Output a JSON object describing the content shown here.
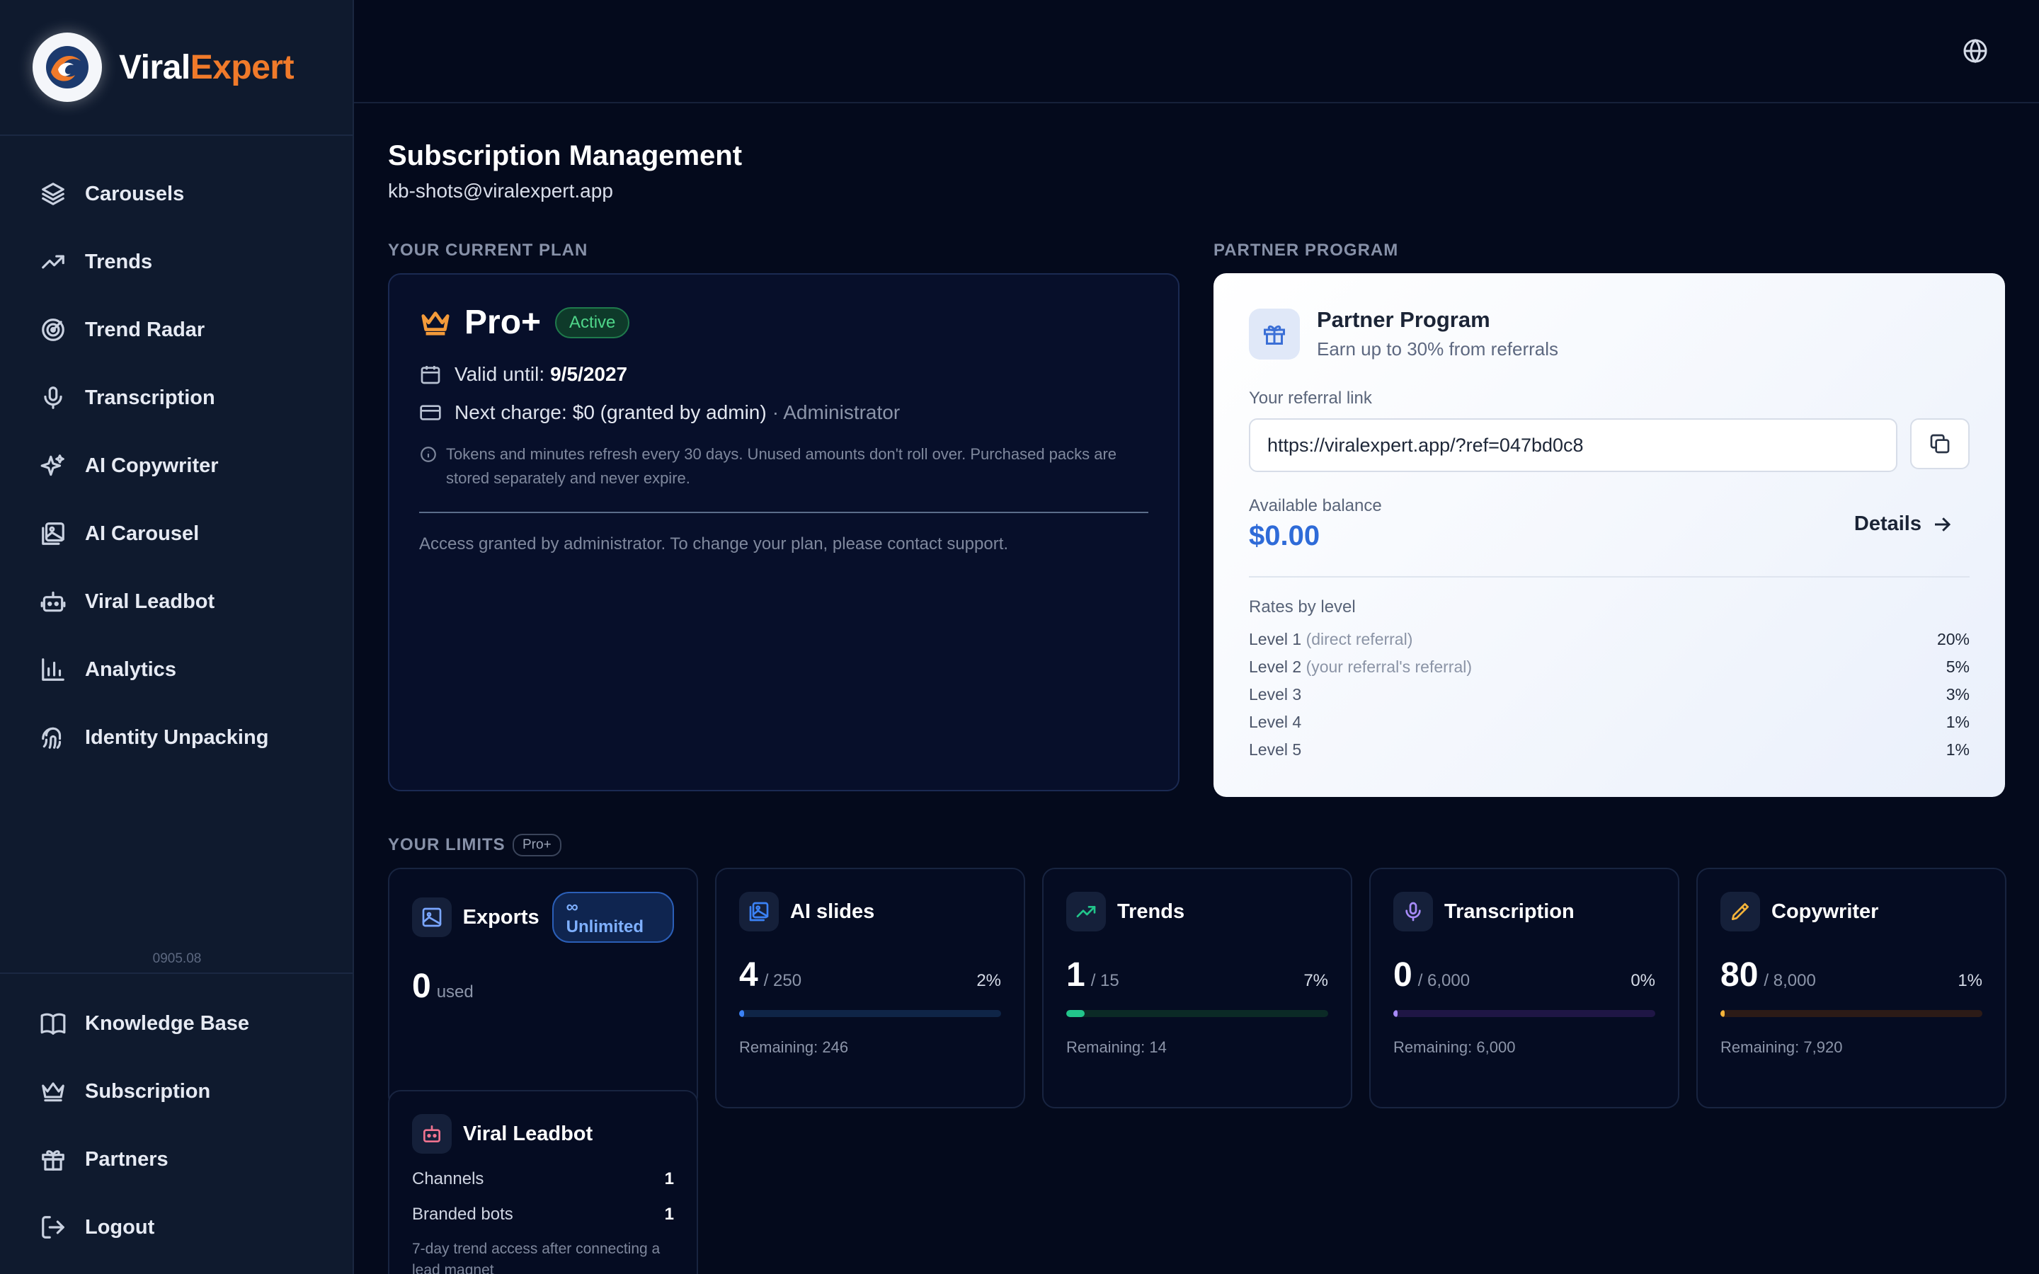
{
  "brand": {
    "name_part1": "Viral",
    "name_part2": "Expert"
  },
  "sidebar": {
    "items": [
      {
        "label": "Carousels",
        "icon": "layers-icon"
      },
      {
        "label": "Trends",
        "icon": "trending-up-icon"
      },
      {
        "label": "Trend Radar",
        "icon": "radar-icon"
      },
      {
        "label": "Transcription",
        "icon": "microphone-icon"
      },
      {
        "label": "AI Copywriter",
        "icon": "sparkles-icon"
      },
      {
        "label": "AI Carousel",
        "icon": "images-icon"
      },
      {
        "label": "Viral Leadbot",
        "icon": "bot-icon"
      },
      {
        "label": "Analytics",
        "icon": "bar-chart-icon"
      },
      {
        "label": "Identity Unpacking",
        "icon": "fingerprint-icon"
      }
    ],
    "version": "0905.08",
    "bottom_items": [
      {
        "label": "Knowledge Base",
        "icon": "book-icon"
      },
      {
        "label": "Subscription",
        "icon": "crown-icon"
      },
      {
        "label": "Partners",
        "icon": "gift-icon"
      },
      {
        "label": "Logout",
        "icon": "logout-icon"
      }
    ]
  },
  "header": {
    "language_icon": "globe-icon"
  },
  "page": {
    "title": "Subscription Management",
    "email": "kb-shots@viralexpert.app"
  },
  "plan": {
    "section_label": "YOUR CURRENT PLAN",
    "name": "Pro+",
    "status": "Active",
    "valid_label": "Valid until:",
    "valid_date": "9/5/2027",
    "charge_label": "Next charge:",
    "charge_value": "$0 (granted by admin)",
    "charge_role": "· Administrator",
    "note": "Tokens and minutes refresh every 30 days. Unused amounts don't roll over. Purchased packs are stored separately and never expire.",
    "footer": "Access granted by administrator. To change your plan, please contact support."
  },
  "partner": {
    "section_label": "PARTNER PROGRAM",
    "title": "Partner Program",
    "subtitle": "Earn up to 30% from referrals",
    "link_label": "Your referral link",
    "link": "https://viralexpert.app/?ref=047bd0c8",
    "balance_label": "Available balance",
    "balance": "$0.00",
    "details_label": "Details",
    "rates_label": "Rates by level",
    "rates": [
      {
        "level": "Level 1",
        "note": "(direct referral)",
        "pct": "20%"
      },
      {
        "level": "Level 2",
        "note": "(your referral's referral)",
        "pct": "5%"
      },
      {
        "level": "Level 3",
        "note": "",
        "pct": "3%"
      },
      {
        "level": "Level 4",
        "note": "",
        "pct": "1%"
      },
      {
        "level": "Level 5",
        "note": "",
        "pct": "1%"
      }
    ]
  },
  "limits": {
    "section_label": "YOUR LIMITS",
    "plan_badge": "Pro+",
    "exports": {
      "title": "Exports",
      "badge": "Unlimited",
      "value": "0",
      "unit": "used",
      "color": "#7aa6ff"
    },
    "cards": [
      {
        "title": "AI slides",
        "value": "4",
        "of": "/ 250",
        "pct": "2%",
        "fraction": 0.02,
        "remaining": "Remaining: 246",
        "color": "#3b82f6",
        "track": "#0f2547",
        "icon": "images-icon"
      },
      {
        "title": "Trends",
        "value": "1",
        "of": "/ 15",
        "pct": "7%",
        "fraction": 0.07,
        "remaining": "Remaining: 14",
        "color": "#22c58b",
        "track": "#0b2a26",
        "icon": "trending-up-icon"
      },
      {
        "title": "Transcription",
        "value": "0",
        "of": "/ 6,000",
        "pct": "0%",
        "fraction": 0.0,
        "remaining": "Remaining: 6,000",
        "color": "#a78bfa",
        "track": "#1f1645",
        "icon": "microphone-icon"
      },
      {
        "title": "Copywriter",
        "value": "80",
        "of": "/ 8,000",
        "pct": "1%",
        "fraction": 0.01,
        "remaining": "Remaining: 7,920",
        "color": "#f5b43a",
        "track": "#2c1b17",
        "icon": "pencil-icon"
      }
    ],
    "leadbot": {
      "title": "Viral Leadbot",
      "rows": [
        {
          "label": "Channels",
          "value": "1"
        },
        {
          "label": "Branded bots",
          "value": "1"
        }
      ],
      "note": "7-day trend access after connecting a lead magnet"
    }
  }
}
